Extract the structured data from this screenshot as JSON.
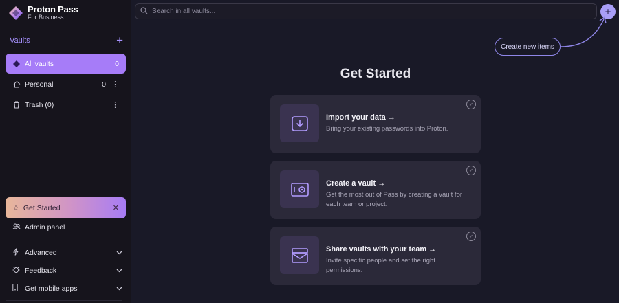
{
  "brand": {
    "name": "Proton Pass",
    "subtitle": "For Business"
  },
  "sidebar": {
    "vaults_title": "Vaults",
    "items": [
      {
        "label": "All vaults",
        "count": "0",
        "icon": "vault-diamond-icon",
        "active": true
      },
      {
        "label": "Personal",
        "count": "0",
        "icon": "house-icon",
        "active": false
      },
      {
        "label": "Trash (0)",
        "count": "",
        "icon": "trash-icon",
        "active": false
      }
    ],
    "get_started": "Get Started",
    "admin_panel": "Admin panel",
    "links": [
      {
        "label": "Advanced",
        "icon": "bolt-icon"
      },
      {
        "label": "Feedback",
        "icon": "bug-icon"
      },
      {
        "label": "Get mobile apps",
        "icon": "mobile-icon"
      }
    ]
  },
  "search": {
    "placeholder": "Search in all vaults..."
  },
  "create_hint": "Create new items",
  "main": {
    "heading": "Get Started",
    "cards": [
      {
        "title": "Import your data →",
        "desc": "Bring your existing passwords into Proton."
      },
      {
        "title": "Create a vault →",
        "desc": "Get the most out of Pass by creating a vault for each team or project."
      },
      {
        "title": "Share vaults with your team →",
        "desc": "Invite specific people and set the right permissions."
      }
    ]
  },
  "colors": {
    "accent": "#a67cf8",
    "background": "#191927",
    "sidebar": "#16141c",
    "card": "#2b2939"
  }
}
